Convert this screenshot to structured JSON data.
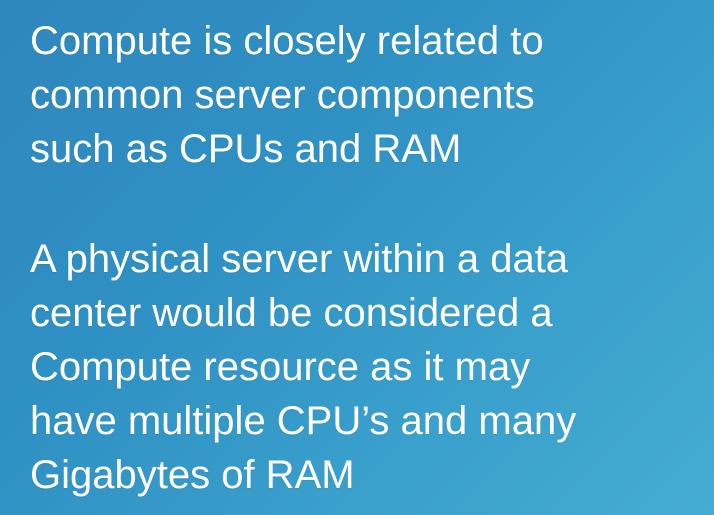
{
  "slide": {
    "paragraphs": [
      {
        "lines": [
          "Compute is closely related to",
          "common server components",
          "such as CPUs and RAM"
        ]
      },
      {
        "lines": [
          "A physical server within a data",
          "center would be considered a",
          "Compute resource as it may",
          "have multiple CPU’s and many",
          "Gigabytes of RAM"
        ]
      }
    ]
  },
  "colors": {
    "background_start": "#2f86bd",
    "background_end": "#45acd3",
    "text": "#ffffff"
  }
}
